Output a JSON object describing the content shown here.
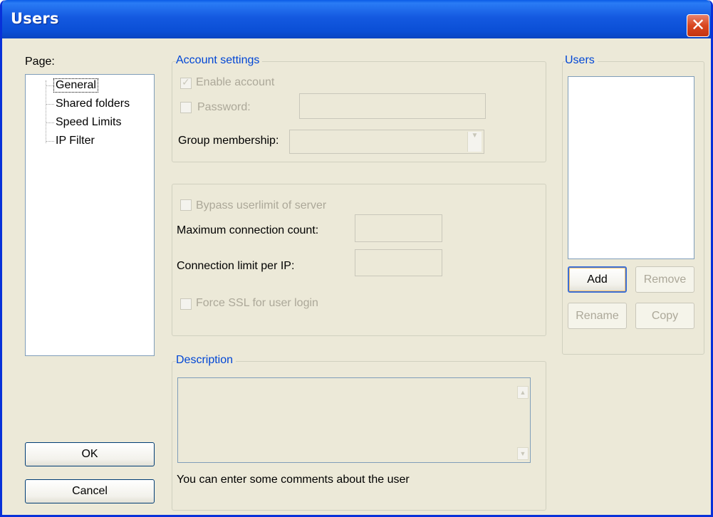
{
  "window": {
    "title": "Users",
    "close_label": "✕"
  },
  "page_panel": {
    "label": "Page:",
    "items": [
      "General",
      "Shared folders",
      "Speed Limits",
      "IP Filter"
    ],
    "selected": "General"
  },
  "account_settings": {
    "title": "Account settings",
    "enable_account": "Enable account",
    "password_label": "Password:",
    "password_value": "",
    "group_label": "Group membership:",
    "group_value": ""
  },
  "limits": {
    "bypass_label": "Bypass userlimit of server",
    "max_conn_label": "Maximum connection count:",
    "max_conn_value": "",
    "conn_ip_label": "Connection limit per IP:",
    "conn_ip_value": "",
    "force_ssl_label": "Force SSL for user login"
  },
  "description": {
    "title": "Description",
    "value": "",
    "hint": "You can enter some comments about the user"
  },
  "users_panel": {
    "title": "Users",
    "items": [],
    "add": "Add",
    "remove": "Remove",
    "rename": "Rename",
    "copy": "Copy"
  },
  "buttons": {
    "ok": "OK",
    "cancel": "Cancel"
  },
  "colors": {
    "title_blue": "#0a4fd6",
    "group_title": "#0046d5",
    "disabled_text": "#aca899",
    "face": "#ece9d8"
  }
}
